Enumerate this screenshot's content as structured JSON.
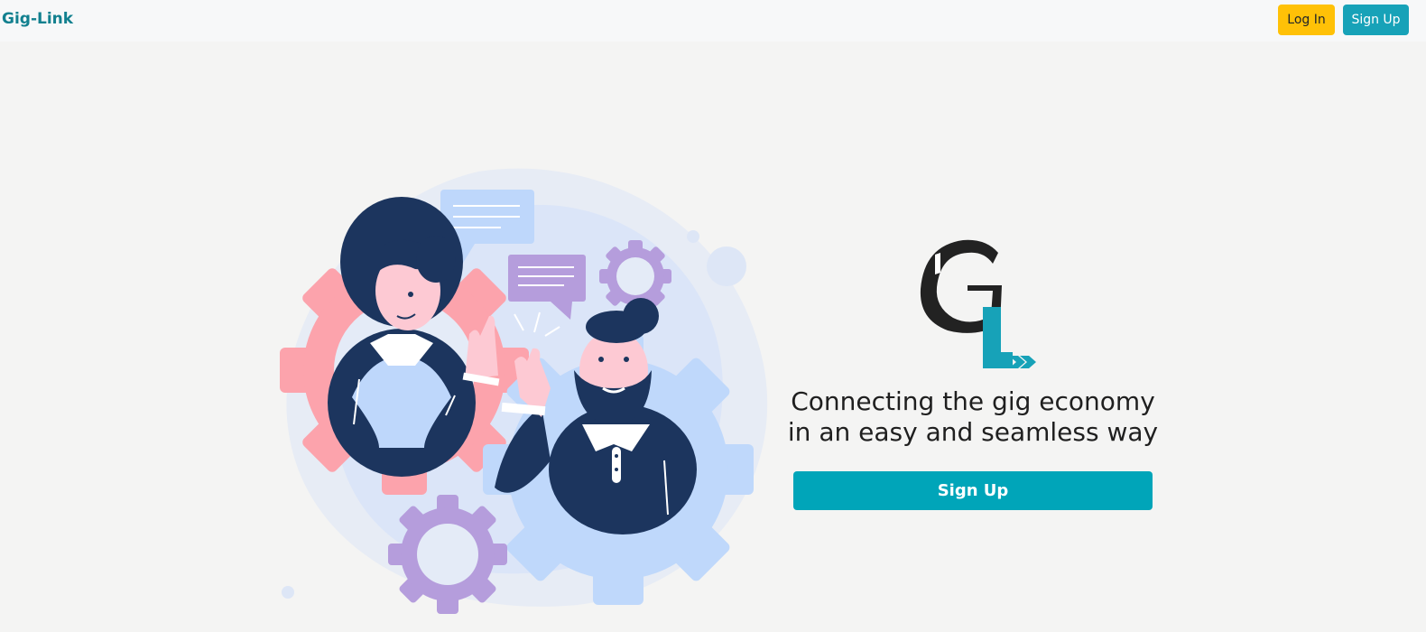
{
  "navbar": {
    "brand": "Gig-Link",
    "login_label": "Log In",
    "signup_label": "Sign Up",
    "colors": {
      "brand": "#12808f",
      "login_bg": "#ffc107",
      "signup_bg": "#17a2b8"
    }
  },
  "hero": {
    "tagline_line1": "Connecting the gig economy",
    "tagline_line2": "in an easy and seamless way",
    "cta_label": "Sign Up",
    "cta_color": "#00a5b9",
    "illustration_icon": "teamwork-gears-illustration",
    "logo_icon": "gig-link-gl-logo"
  }
}
